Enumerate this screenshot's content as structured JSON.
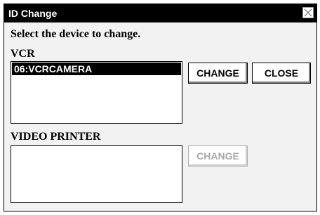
{
  "dialog": {
    "title": "ID Change",
    "instruction": "Select the device to change."
  },
  "vcr": {
    "label": "VCR",
    "items": [
      "06:VCRCAMERA"
    ],
    "selected_index": 0,
    "change_label": "CHANGE",
    "close_label": "CLOSE"
  },
  "printer": {
    "label": "VIDEO PRINTER",
    "items": [],
    "change_label": "CHANGE",
    "change_enabled": false
  },
  "icons": {
    "close": "close-icon"
  }
}
